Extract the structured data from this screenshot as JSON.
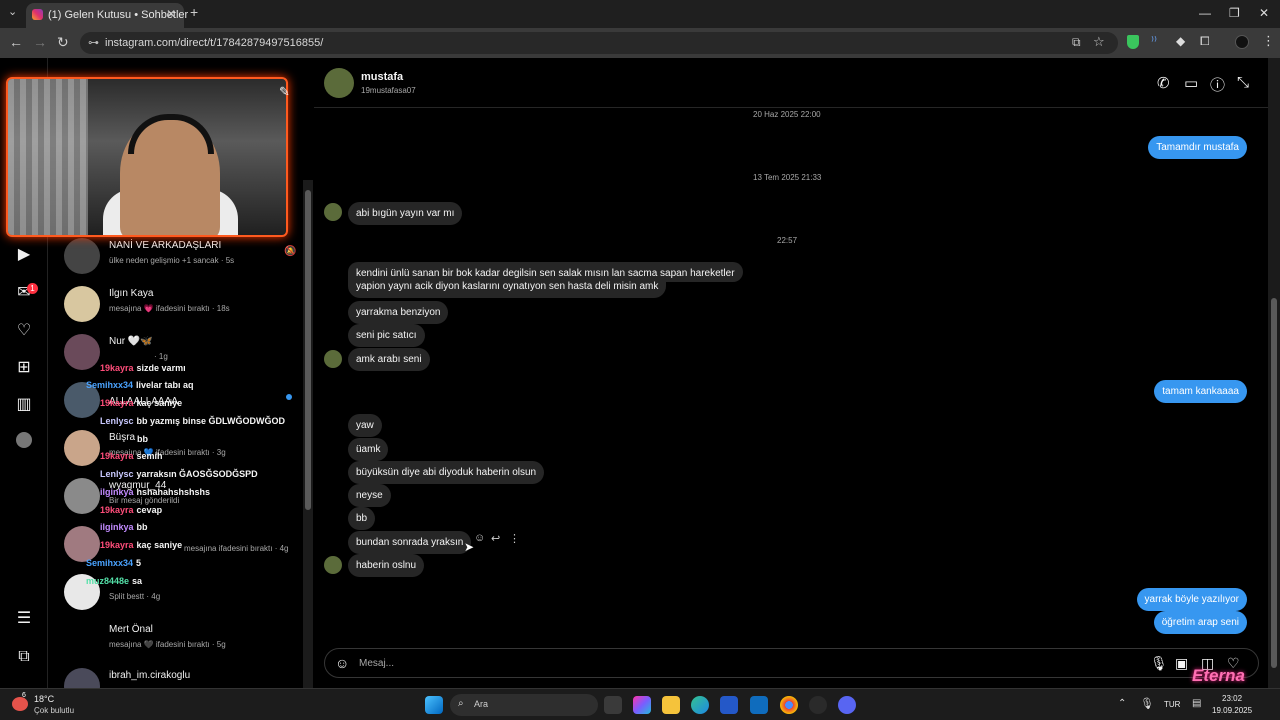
{
  "browser": {
    "tab_title": "(1) Gelen Kutusu • Sohbetler",
    "tab_close": "✕",
    "new_tab": "+",
    "url": "instagram.com/direct/t/17842879497516855/",
    "nav": {
      "back": "←",
      "forward": "→",
      "reload": "↻"
    },
    "window": {
      "minimize": "—",
      "restore": "❐",
      "close": "✕"
    }
  },
  "rail": {
    "icons": [
      "reels-icon",
      "messenger-icon",
      "heart-icon",
      "plus-icon",
      "dashboard-icon",
      "profile-icon",
      "menu-icon",
      "meta-icon"
    ],
    "notification_count": "1"
  },
  "conversations": [
    {
      "name": "NANİ VE ARKADAŞLARI",
      "preview": "ülke neden gelişmio +1 sancak · 5s"
    },
    {
      "name": "Ilgın Kaya",
      "preview": "mesajına 💗 ifadesini bıraktı · 18s"
    },
    {
      "name": "Nur 🤍🦋",
      "preview": "· 1g"
    },
    {
      "name": "ALLAALLAAAA",
      "preview": ""
    },
    {
      "name": "Büşra",
      "preview": "mesajına 💙 ifadesini bıraktı · 3g"
    },
    {
      "name": "wyagmur_44",
      "preview": "Bir mesaj gönderildi"
    },
    {
      "name": "",
      "preview": "mesajına ifadesini bıraktı · 4g"
    },
    {
      "name": "",
      "preview": "Split bestt · 4g"
    },
    {
      "name": "Mert Önal",
      "preview": "mesajına 🖤 ifadesini bıraktı · 5g"
    },
    {
      "name": "ibrah_im.cirakoglu",
      "preview": ""
    }
  ],
  "stream_chat": [
    {
      "user": "19kayra",
      "text": "sizde varmı",
      "color": "#ff4d7a"
    },
    {
      "user": "Semihxx34",
      "text": "livelar tabı aq",
      "color": "#4aa3ff"
    },
    {
      "user": "19kayra",
      "text": "kaç saniye",
      "color": "#ff4d7a"
    },
    {
      "user": "Lenlysc",
      "text": "bb yazmış binse ĞDLWĞODWĞOD",
      "color": "#c9c9ff"
    },
    {
      "user": "",
      "text": "bb",
      "color": "#ff4d7a"
    },
    {
      "user": "19kayra",
      "text": "semih",
      "color": "#ff4d7a"
    },
    {
      "user": "Lenlysc",
      "text": "yarraksın ĞAOSĞSODĞSPD",
      "color": "#c9c9ff"
    },
    {
      "user": "ilginkya",
      "text": "hshahahshshshs",
      "color": "#c28bff"
    },
    {
      "user": "19kayra",
      "text": "cevap",
      "color": "#ff4d7a"
    },
    {
      "user": "ilginkya",
      "text": "bb",
      "color": "#c28bff"
    },
    {
      "user": "19kayra",
      "text": "kaç saniye",
      "color": "#ff4d7a"
    },
    {
      "user": "Semihxx34",
      "text": "5",
      "color": "#4aa3ff"
    },
    {
      "user": "muz8448e",
      "text": "sa",
      "color": "#54e0a8"
    }
  ],
  "chat": {
    "name": "mustafa",
    "username": "19mustafasa07",
    "header_icons": [
      "phone-icon",
      "video-icon",
      "info-icon",
      "collapse-icon"
    ],
    "messages": [
      {
        "type": "timestamp",
        "text": "20 Haz 2025 22:00"
      },
      {
        "type": "out",
        "text": "Tamamdır mustafa"
      },
      {
        "type": "timestamp",
        "text": "13 Tem 2025 21:33"
      },
      {
        "type": "in",
        "text": "abi bıgün yayın var mı"
      },
      {
        "type": "timestamp",
        "text": "22:57"
      },
      {
        "type": "in",
        "text": "kendini ünlü sanan bir bok kadar degilsin sen salak mısın lan sacma sapan hareketler"
      },
      {
        "type": "in",
        "text": "yapion yaynı acik diyon kaslarını oynatıyon sen hasta deli misin amk"
      },
      {
        "type": "in",
        "text": "yarrakma benziyon"
      },
      {
        "type": "in",
        "text": "seni pic satıcı"
      },
      {
        "type": "in",
        "text": "amk arabı seni"
      },
      {
        "type": "out",
        "text": "tamam kankaaaa"
      },
      {
        "type": "in",
        "text": "yaw"
      },
      {
        "type": "in",
        "text": "üamk"
      },
      {
        "type": "in",
        "text": "büyüksün diye abi diyoduk haberin olsun"
      },
      {
        "type": "in",
        "text": "neyse"
      },
      {
        "type": "in",
        "text": "bb"
      },
      {
        "type": "in",
        "text": "bundan sonrada yraksın"
      },
      {
        "type": "in",
        "text": "haberin oslnu"
      },
      {
        "type": "out",
        "text": "yarrak böyle yazılıyor"
      },
      {
        "type": "out",
        "text": "öğretim arap seni"
      }
    ]
  },
  "composer": {
    "placeholder": "Mesaj..."
  },
  "taskbar": {
    "weather_temp": "18°C",
    "weather_desc": "Çok bulutlu",
    "weather_badge": "6",
    "search_placeholder": "Ara",
    "language": "TUR",
    "time": "23:02",
    "date": "19.09.2025"
  },
  "colors": {
    "accent": "#3797f0",
    "incoming": "#262626",
    "overlay_border": "#ff5a1f"
  }
}
